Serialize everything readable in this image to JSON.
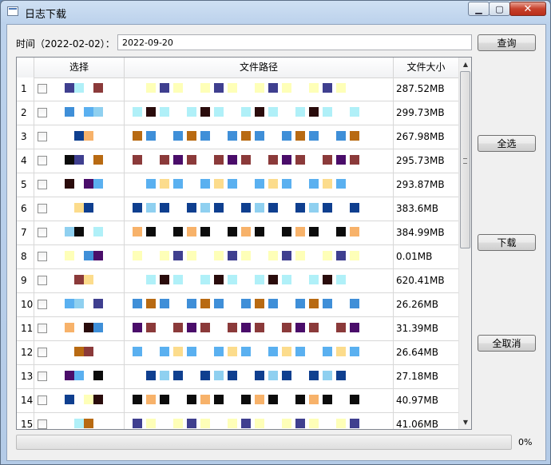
{
  "window": {
    "title": "日志下载"
  },
  "query": {
    "label": "时间（2022-02-02）：",
    "date_value": "2022-09-20",
    "query_button": "查询"
  },
  "buttons": {
    "select_all": "全选",
    "download": "下载",
    "deselect_all": "全取消"
  },
  "table": {
    "columns": [
      "选择",
      "文件路径",
      "文件大小"
    ],
    "rows": [
      {
        "num": "1",
        "size": "287.52MB",
        "checked": false
      },
      {
        "num": "2",
        "size": "299.73MB",
        "checked": false
      },
      {
        "num": "3",
        "size": "267.98MB",
        "checked": false
      },
      {
        "num": "4",
        "size": "295.73MB",
        "checked": false
      },
      {
        "num": "5",
        "size": "293.87MB",
        "checked": false
      },
      {
        "num": "6",
        "size": "383.6MB",
        "checked": false
      },
      {
        "num": "7",
        "size": "384.99MB",
        "checked": false
      },
      {
        "num": "8",
        "size": "0.01MB",
        "checked": false
      },
      {
        "num": "9",
        "size": "620.41MB",
        "checked": false
      },
      {
        "num": "10",
        "size": "26.26MB",
        "checked": false
      },
      {
        "num": "11",
        "size": "31.39MB",
        "checked": false
      },
      {
        "num": "12",
        "size": "26.64MB",
        "checked": false
      },
      {
        "num": "13",
        "size": "27.18MB",
        "checked": false
      },
      {
        "num": "14",
        "size": "40.97MB",
        "checked": false
      },
      {
        "num": "15",
        "size": "41.06MB",
        "checked": false
      }
    ]
  },
  "progress": {
    "value": 0,
    "text": "0%"
  },
  "colors": {
    "redaction_palette": [
      "#3f3f8f",
      "#8b3a3a",
      "#f7b26a",
      "#3f8fd8",
      "#8fd0f0",
      "#b0f0f8",
      "#fcdc8c",
      "#feffb8",
      "#4a0d6a",
      "#0c0c0c",
      "#b86a12",
      "#0f3f8f",
      "#2a0c0c",
      "#5ab0f0"
    ],
    "progress_fill": "#26b240"
  }
}
